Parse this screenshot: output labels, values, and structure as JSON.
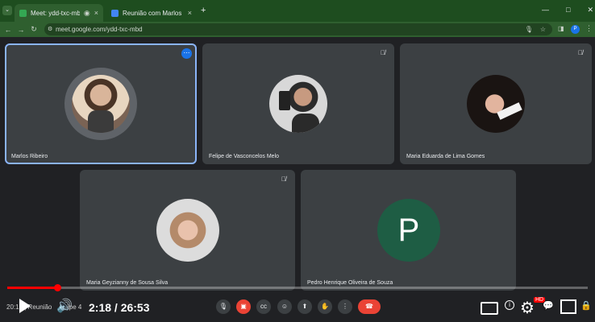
{
  "browser": {
    "tabs": [
      {
        "label": "Meet: ydd-txc-mbd",
        "close": "×"
      },
      {
        "label": "Reunião com Marlos - Docume",
        "close": "×"
      }
    ],
    "new_tab": "+",
    "url": "meet.google.com/ydd-txc-mbd"
  },
  "participants": [
    {
      "name": "Marlos Ribeiro"
    },
    {
      "name": "Felipe de Vasconcelos Melo"
    },
    {
      "name": "Maria Eduarda de Lima Gomes"
    },
    {
      "name": "Maria Geyzianny de Sousa Silva"
    },
    {
      "name": "Pedro Henrique Oliveira de Souza",
      "initial": "P"
    }
  ],
  "player": {
    "left_caption": "20:16 | Reunião",
    "left_caption2": "ipe 4",
    "time": "2:18 / 26:53",
    "progress": 0.086,
    "hd_badge": "HD"
  },
  "colors": {
    "tab_strip": "#1e4d1f",
    "tile_bg": "#3c4043",
    "speaking_outline": "#8ab4f8",
    "leave_button": "#ea4335",
    "progress": "#ff0000",
    "pedro_avatar": "#1e5d44"
  }
}
